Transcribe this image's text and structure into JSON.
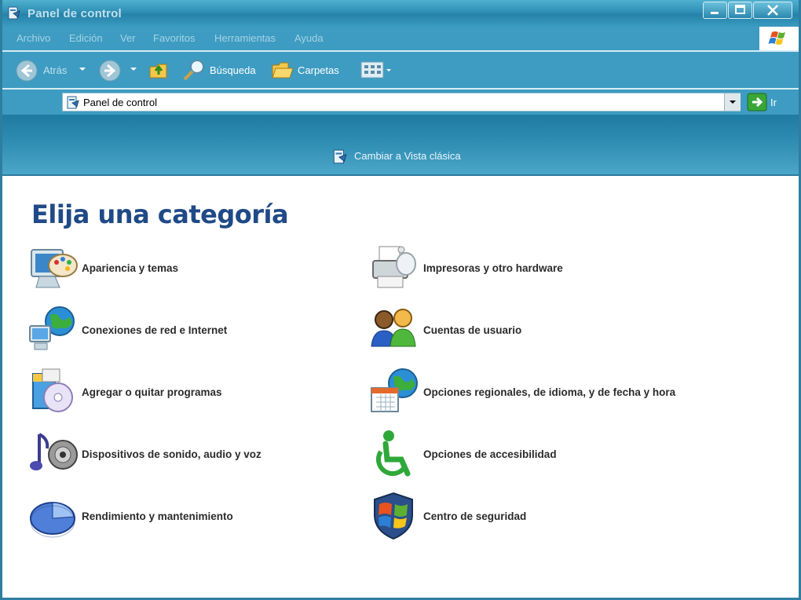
{
  "window": {
    "title": "Panel de control"
  },
  "menu": {
    "items": [
      "Archivo",
      "Edición",
      "Ver",
      "Favoritos",
      "Herramientas",
      "Ayuda"
    ]
  },
  "toolbar": {
    "back_label": "Atrás",
    "search_label": "Búsqueda",
    "folders_label": "Carpetas"
  },
  "address": {
    "value": "Panel de control",
    "go_label": "Ir"
  },
  "taskband": {
    "switch_label": "Cambiar a Vista clásica"
  },
  "main": {
    "heading": "Elija una categoría",
    "categories_left": [
      {
        "label": "Apariencia y temas",
        "icon": "appearance-themes-icon"
      },
      {
        "label": "Conexiones de red e Internet",
        "icon": "network-connections-icon"
      },
      {
        "label": "Agregar o quitar programas",
        "icon": "add-remove-programs-icon"
      },
      {
        "label": "Dispositivos de sonido, audio y voz",
        "icon": "sound-devices-icon"
      },
      {
        "label": "Rendimiento y mantenimiento",
        "icon": "performance-maintenance-icon"
      }
    ],
    "categories_right": [
      {
        "label": "Impresoras y otro hardware",
        "icon": "printer-hardware-icon"
      },
      {
        "label": "Cuentas de usuario",
        "icon": "user-accounts-icon"
      },
      {
        "label": "Opciones regionales, de idioma, y de fecha y hora",
        "icon": "regional-options-icon"
      },
      {
        "label": "Opciones de accesibilidad",
        "icon": "accessibility-icon"
      },
      {
        "label": "Centro de seguridad",
        "icon": "security-center-icon"
      }
    ]
  },
  "colors": {
    "heading": "#204a87",
    "chrome": "#3e9cc2",
    "band": "#2d8ab0"
  }
}
